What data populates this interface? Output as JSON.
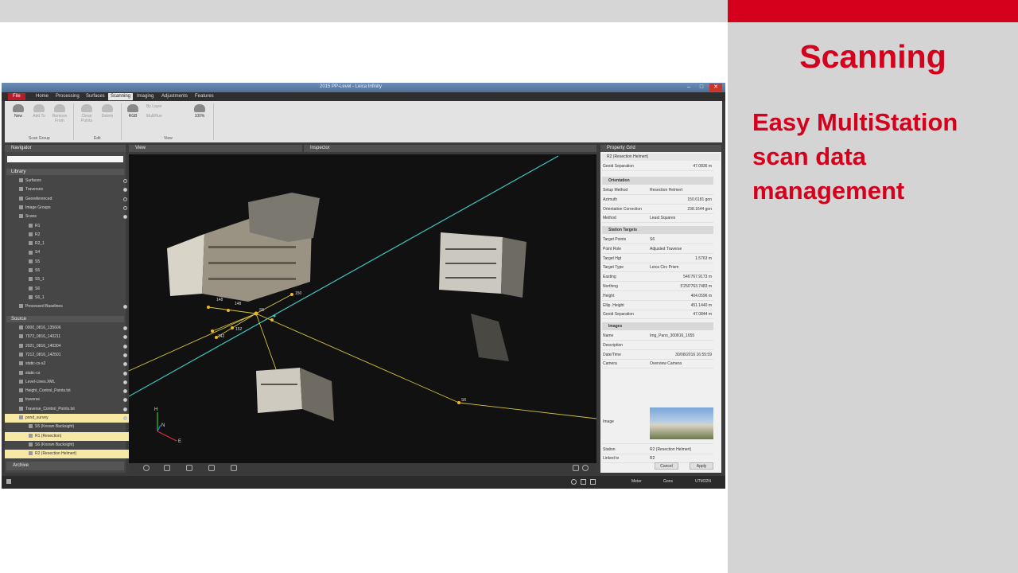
{
  "slide": {
    "title": "Scanning",
    "subtitle": "Easy MultiStation scan data management"
  },
  "app": {
    "title": "2015 PP-Level - Leica Infinity",
    "window_controls": {
      "min": "–",
      "max": "□",
      "close": "✕"
    },
    "menu": [
      "File",
      "Home",
      "Processing",
      "Surfaces",
      "Scanning",
      "Imaging",
      "Adjustments",
      "Features"
    ],
    "ribbon": {
      "new": "New",
      "add_to": "Add To",
      "remove_from": "Remove From",
      "clean_points": "Clean Points",
      "delete": "Delete",
      "rgb": "RGB",
      "by_layer": "By Layer",
      "multi_hue": "MultiHue",
      "zoom": "100%",
      "groups": {
        "scan_group": "Scan Group",
        "edit": "Edit",
        "view": "View"
      }
    },
    "navigator": {
      "title": "Navigator",
      "library_label": "Library",
      "library": [
        {
          "label": "Surfaces",
          "eye": false
        },
        {
          "label": "Traverses",
          "eye": true
        },
        {
          "label": "Georeferenced",
          "eye": false
        },
        {
          "label": "Image Groups",
          "eye": false
        },
        {
          "label": "Scans",
          "eye": true
        },
        {
          "label": "R1",
          "eye": false
        },
        {
          "label": "R2",
          "eye": false
        },
        {
          "label": "R2_1",
          "eye": false
        },
        {
          "label": "S4",
          "eye": true
        },
        {
          "label": "S5",
          "eye": true
        },
        {
          "label": "S5",
          "eye": false
        },
        {
          "label": "S5_1",
          "eye": true
        },
        {
          "label": "S6",
          "eye": false
        },
        {
          "label": "S6_1",
          "eye": false
        },
        {
          "label": "Processed Baselines",
          "eye": true
        }
      ],
      "source_label": "Source",
      "source": [
        {
          "label": "0000_0816_135606",
          "eye": true,
          "hl": false
        },
        {
          "label": "7972_0816_140211",
          "eye": true,
          "hl": false
        },
        {
          "label": "2021_0816_140304",
          "eye": true,
          "hl": false
        },
        {
          "label": "7212_0816_142501",
          "eye": true,
          "hl": false
        },
        {
          "label": "static-cs-s2",
          "eye": true,
          "hl": false
        },
        {
          "label": "static-cs",
          "eye": true,
          "hl": false
        },
        {
          "label": "Level-Lines.XML",
          "eye": true,
          "hl": false
        },
        {
          "label": "Height_Control_Points.txt",
          "eye": true,
          "hl": false
        },
        {
          "label": "traverse",
          "eye": true,
          "hl": false
        },
        {
          "label": "Traverse_Control_Points.txt",
          "eye": true,
          "hl": false
        },
        {
          "label": "pond_survey",
          "eye": true,
          "hl": true
        },
        {
          "label": "S5 (Known Backsight)",
          "eye": true,
          "hl": false
        },
        {
          "label": "R1 (Resection)",
          "eye": true,
          "hl": true
        },
        {
          "label": "S6 (Known Backsight)",
          "eye": false,
          "hl": false
        },
        {
          "label": "R2 (Resection Helmert)",
          "eye": false,
          "hl": true
        }
      ],
      "archive": "Archive"
    },
    "tabs": {
      "view": "View",
      "inspector": "Inspector"
    },
    "viewport": {
      "labels": [
        "150",
        "148",
        "148",
        "S5",
        "152",
        "142",
        "S6"
      ],
      "axes": {
        "h": "H",
        "n": "N",
        "e": "E"
      }
    },
    "property_grid": {
      "title": "Property Grid",
      "selection": "R2 (Resection Helmert)",
      "top_row": {
        "key": "Geoid Separation",
        "value": "47.0836 m"
      },
      "orientation": {
        "label": "Orientation",
        "rows": [
          {
            "k": "Setup Method",
            "v": "Resection Helmert",
            "num": false
          },
          {
            "k": "Azimuth",
            "v": "150.6181 gon",
            "num": true
          },
          {
            "k": "Orientation Correction",
            "v": "238.1644 gon",
            "num": true
          },
          {
            "k": "Method",
            "v": "Least Squares",
            "num": false
          }
        ]
      },
      "station_targets": {
        "label": "Station Targets",
        "rows": [
          {
            "k": "Target Points",
            "v": "S6",
            "num": false
          },
          {
            "k": "Point Role",
            "v": "Adjusted Traverse",
            "num": false
          },
          {
            "k": "Target Hgt",
            "v": "1.5763 m",
            "num": true
          },
          {
            "k": "Target Type",
            "v": "Leica Circ Prism",
            "num": false
          },
          {
            "k": "Easting",
            "v": "546'767.9173 m",
            "num": true
          },
          {
            "k": "Northing",
            "v": "5'250'763.7483 m",
            "num": true
          },
          {
            "k": "Height",
            "v": "404.0596 m",
            "num": true
          },
          {
            "k": "Ellip. Height",
            "v": "451.1440 m",
            "num": true
          },
          {
            "k": "Geoid Separation",
            "v": "47.0844 m",
            "num": true
          }
        ]
      },
      "images": {
        "label": "Images",
        "rows": [
          {
            "k": "Name",
            "v": "Img_Pano_300816_1655",
            "num": false
          },
          {
            "k": "Description",
            "v": "",
            "num": false
          },
          {
            "k": "Date/Time",
            "v": "30/08/2016 16:55:59",
            "num": true
          },
          {
            "k": "Camera",
            "v": "Overview Camera",
            "num": false
          }
        ],
        "image_label": "Image",
        "station_key": "Station",
        "station_value": "R2 (Resection Helmert)",
        "linked_key": "Linked to",
        "linked_value": "R2"
      },
      "buttons": {
        "cancel": "Cancel",
        "apply": "Apply"
      }
    },
    "status": {
      "unit": "Meter",
      "angle": "Gons",
      "projection": "UTM32N"
    }
  }
}
